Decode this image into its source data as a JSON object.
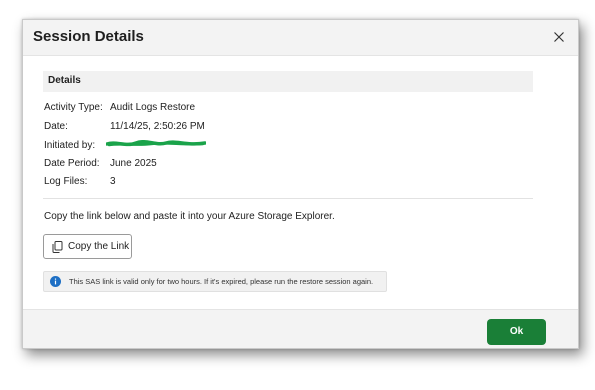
{
  "dialog": {
    "title": "Session Details",
    "close_icon": "close-icon"
  },
  "details": {
    "section_title": "Details",
    "rows": [
      {
        "label": "Activity Type:",
        "value": "Audit Logs Restore"
      },
      {
        "label": "Date:",
        "value": "11/14/25, 2:50:26 PM"
      },
      {
        "label": "Initiated by:",
        "value": ""
      },
      {
        "label": "Date Period:",
        "value": "June 2025"
      },
      {
        "label": "Log Files:",
        "value": "3"
      }
    ]
  },
  "instruction": "Copy the link below and paste it into your Azure Storage Explorer.",
  "copy_button": {
    "label": "Copy the Link",
    "icon": "copy-icon"
  },
  "notice": {
    "icon": "info-icon",
    "text": "This SAS link is valid only for two hours. If it's expired, please run the restore session again."
  },
  "footer": {
    "ok_label": "Ok"
  },
  "colors": {
    "accent": "#1a7f37",
    "info": "#1e6fc4",
    "redaction": "#1aa34a"
  }
}
